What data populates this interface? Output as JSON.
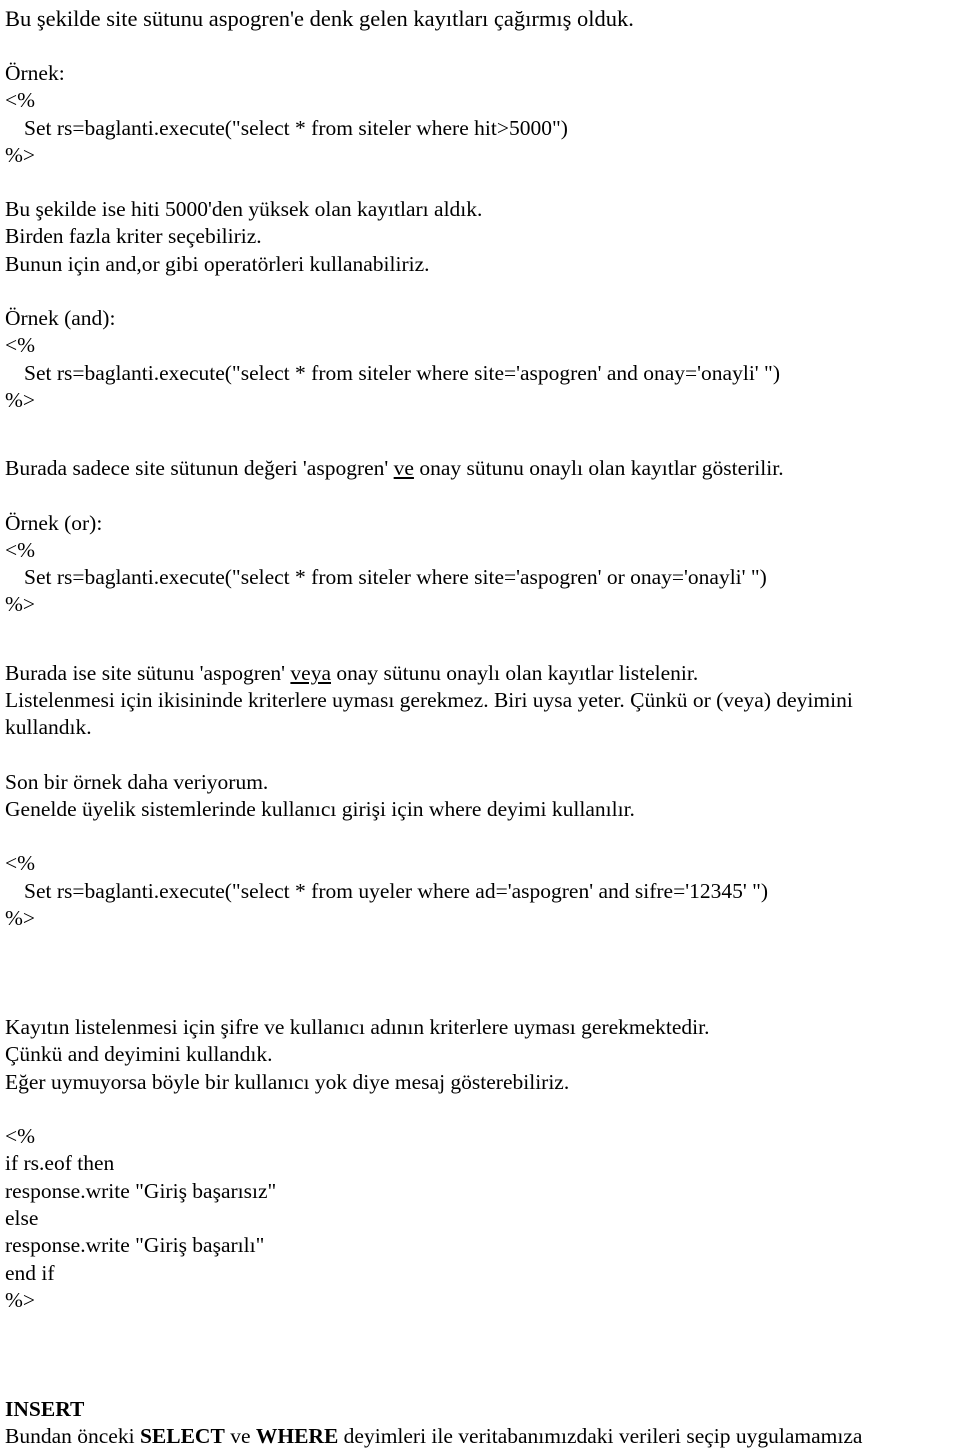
{
  "document": {
    "language": "tr",
    "background_color": "#ffffff",
    "text_color": "#000000",
    "blocks": {
      "intro_line": "Bu şekilde site sütunu aspogren'e denk gelen kayıtları çağırmış olduk.",
      "ornek_label": "Örnek:",
      "asp_open_1": "<%",
      "code_1": "Set rs=baglanti.execute(\"select * from siteler where hit>5000\")",
      "asp_close_1": "%>",
      "para_1_line_1": "Bu şekilde ise hiti 5000'den yüksek olan kayıtları aldık.",
      "para_1_line_2": "Birden fazla kriter seçebiliriz.",
      "para_1_line_3": "Bunun için and,or gibi operatörleri kullanabiliriz.",
      "ornek_and_label": "Örnek (and):",
      "asp_open_2": "<%",
      "code_2": "Set rs=baglanti.execute(\"select * from siteler where site='aspogren' and onay='onayli' \")",
      "asp_close_2": "%>",
      "para_2_prefix": "Burada sadece site sütunun değeri 'aspogren' ",
      "para_2_underlined": "ve",
      "para_2_suffix": " onay sütunu onaylı olan kayıtlar gösterilir.",
      "ornek_or_label": "Örnek (or):",
      "asp_open_3": "<%",
      "code_3": "Set rs=baglanti.execute(\"select * from siteler where site='aspogren' or onay='onayli' \")",
      "asp_close_3": "%>",
      "para_3_prefix": "Burada ise site sütunu 'aspogren' ",
      "para_3_underlined": "veya",
      "para_3_suffix": " onay sütunu onaylı olan kayıtlar listelenir.",
      "para_3_line_2": "Listelenmesi için ikisininde kriterlere uyması gerekmez. Biri uysa yeter. Çünkü or (veya) deyimini",
      "para_3_line_3": "kullandık.",
      "para_4_line_1": "Son bir örnek daha veriyorum.",
      "para_4_line_2": "Genelde üyelik sistemlerinde kullanıcı girişi için where deyimi kullanılır.",
      "asp_open_4": "<%",
      "code_4": "Set rs=baglanti.execute(\"select * from uyeler where ad='aspogren' and sifre='12345' \")",
      "asp_close_4": "%>",
      "para_5_line_1": "Kayıtın listelenmesi için şifre ve kullanıcı adının kriterlere uyması gerekmektedir.",
      "para_5_line_2": "Çünkü and deyimini kullandık.",
      "para_5_line_3": "Eğer uymuyorsa böyle bir kullanıcı yok diye mesaj gösterebiliriz.",
      "asp_open_5": "<%",
      "code_5_line_1": "if rs.eof then",
      "code_5_line_2": "response.write \"Giriş başarısız\"",
      "code_5_line_3": "else",
      "code_5_line_4": "response.write \"Giriş başarılı\"",
      "code_5_line_5": "end if",
      "asp_close_5": "%>",
      "insert_heading": "INSERT",
      "closing_prefix": "Bundan önceki ",
      "closing_bold_1": "SELECT",
      "closing_middle": " ve ",
      "closing_bold_2": "WHERE",
      "closing_suffix": " deyimleri ile veritabanımızdaki verileri seçip uygulamamıza"
    }
  }
}
